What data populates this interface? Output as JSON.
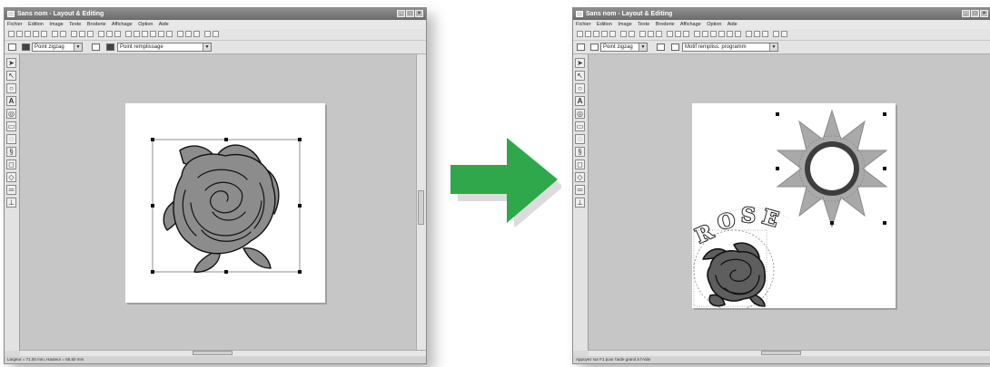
{
  "before": {
    "title": "Sans nom - Layout & Editing",
    "menu": [
      "Fichier",
      "Edition",
      "Image",
      "Texte",
      "Broderie",
      "Affichage",
      "Option",
      "Aide"
    ],
    "sew_type_1": "Point zigzag",
    "sew_type_2": "Point remplissage",
    "status": "Largeur = 71.00 mm, Hauteur = 65.50 mm"
  },
  "after": {
    "title": "Sans nom - Layout & Editing",
    "menu": [
      "Fichier",
      "Edition",
      "Image",
      "Texte",
      "Broderie",
      "Affichage",
      "Option",
      "Aide"
    ],
    "sew_type_1": "Point zigzag",
    "sew_type_2": "Motif rempliss. programm",
    "status": "Appuyez sur F1 pour l'aide grand à l'Aide",
    "text_on_path": "ROSE"
  },
  "colors": {
    "arrow": "#2ea84a",
    "canvas": "#c6c6c6",
    "titlebar": "#7a7a7a",
    "rose_fill": "#8c8c8c",
    "sun_fill": "#a9a9a9"
  },
  "icons": {
    "arrow": "right-arrow-icon",
    "select": "pointer-icon",
    "text": "letter-a-icon",
    "zoom": "magnifier-icon"
  }
}
